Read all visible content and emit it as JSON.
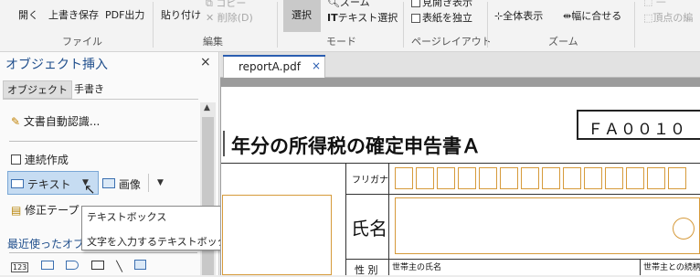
{
  "ribbon": {
    "file": {
      "open": "開く",
      "overwrite_save": "上書き保存",
      "pdf_out": "PDF出力",
      "label": "ファイル"
    },
    "edit": {
      "paste": "貼り付け",
      "copy": "コピー",
      "delete": "削除(D)",
      "label": "編集"
    },
    "mode": {
      "select": "選択",
      "zoom": "ズーム",
      "text_select": "テキスト選択",
      "label": "モード"
    },
    "layout": {
      "view": "見開き表示",
      "independent": "表紙を独立",
      "label": "ページレイアウト"
    },
    "zoomgrp": {
      "full": "全体表示",
      "fit_width": "幅に合せる",
      "label": "ズーム"
    },
    "right": {
      "vertex_edit": "頂点の編"
    }
  },
  "pane": {
    "title": "オブジェクト挿入",
    "close": "×",
    "tabs": [
      "オブジェクト",
      "手書き"
    ],
    "auto_recognize": "文書自動認識...",
    "continuous": "連続作成",
    "text_btn": "テキスト",
    "image_btn": "画像",
    "correction_tape": "修正テープ",
    "recent": "最近使ったオブジ",
    "tooltip_title": "テキストボックス",
    "tooltip_desc": "文字を入力するテキストボックスを作成します。",
    "recent_icon": "123"
  },
  "document": {
    "tab_name": "reportA.pdf",
    "tab_close": "×",
    "form_code": "ＦＡ００１０",
    "title": "年分の所得税の確定申告書Ａ",
    "furigana": "フリガナ",
    "name_label": "氏名",
    "sex_label": "性 別",
    "householder": "世帯主の氏名",
    "relation": "世帯主との続柄"
  }
}
